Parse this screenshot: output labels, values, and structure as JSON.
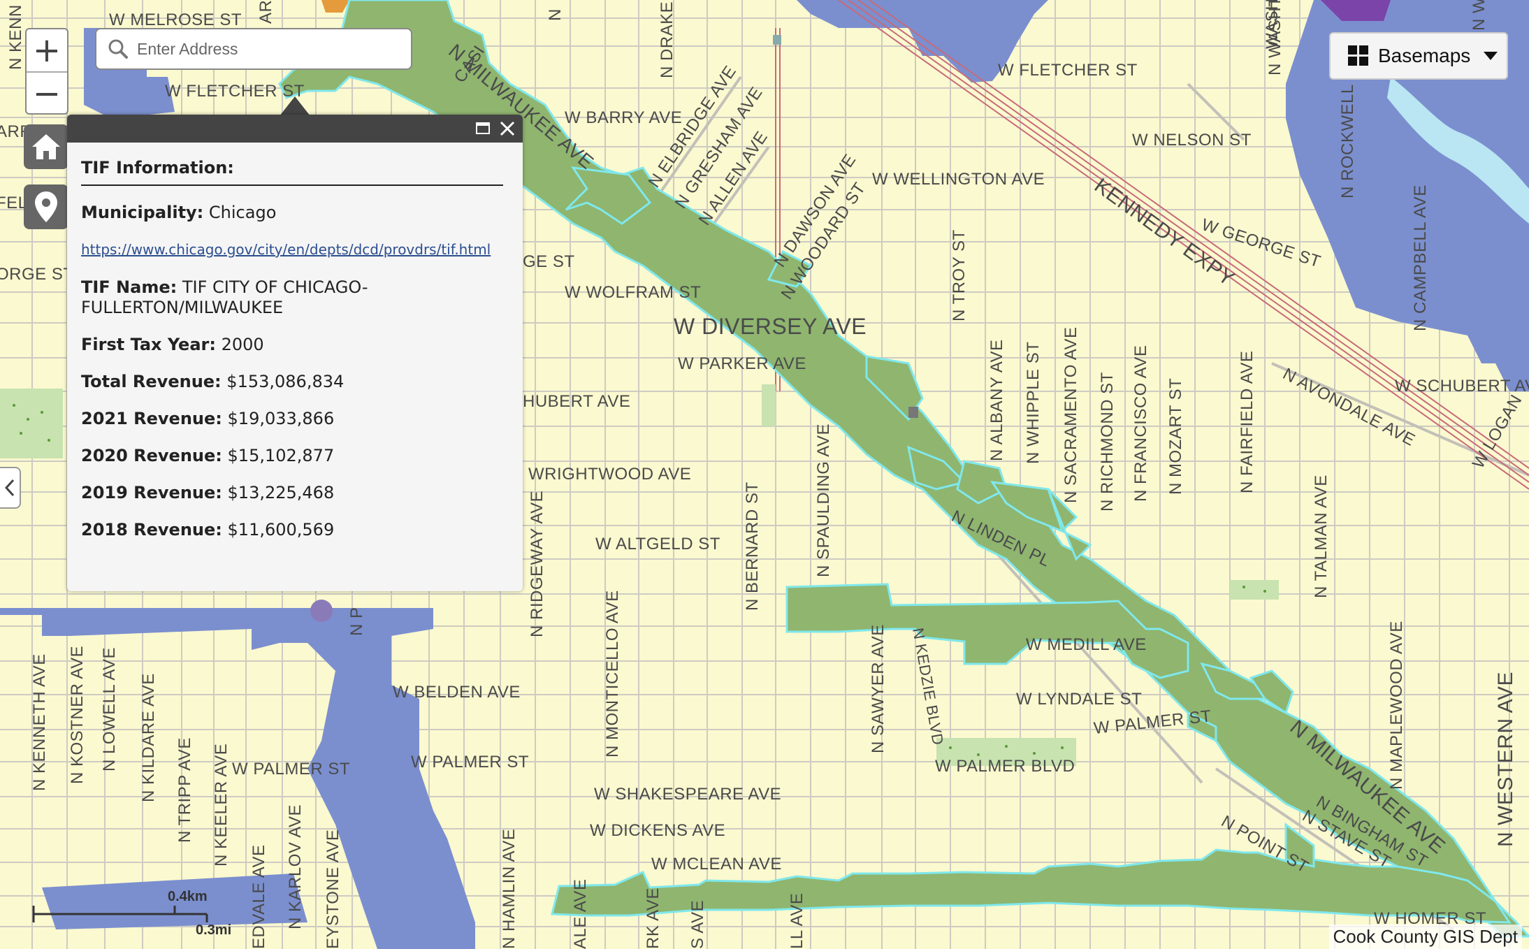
{
  "map": {
    "streets": [
      "W MELROSE ST",
      "W FLETCHER ST",
      "W FLETCHER ST",
      "W BARRY AVE",
      "W NELSON ST",
      "W WELLINGTON AVE",
      "W GEORGE ST",
      "KENNEDY EXPY",
      "W WOLFRAM ST",
      "W DIVERSEY AVE",
      "W PARKER AVE",
      "W SCHUBERT AVE",
      "N AVONDALE AVE",
      "WRIGHTWOOD AVE",
      "W ALTGELD ST",
      "N LINDEN PL",
      "W MEDILL AVE",
      "W LYNDALE ST",
      "W PALMER ST",
      "W BELDEN AVE",
      "W PALMER ST",
      "W PALMER ST",
      "W PALMER BLVD",
      "W SHAKESPEARE AVE",
      "W DICKENS AVE",
      "W MCLEAN AVE",
      "N MILWAUKEE AVE",
      "N MILWAUKEE AVE",
      "N ELBRIDGE AVE",
      "N GRESHAM AVE",
      "N ALLEN AVE",
      "N DAWSON AVE",
      "N WOODARD ST",
      "N TROY ST",
      "N ALBANY AVE",
      "N WHIPPLE ST",
      "N SACRAMENTO AVE",
      "N RICHMOND ST",
      "N FRANCISCO AVE",
      "N MOZART ST",
      "N FAIRFIELD AVE",
      "N TALMAN AVE",
      "N MAPLEWOOD AVE",
      "N WESTERN AVE",
      "N ROCKWELL",
      "N CAMPBELL AVE",
      "N WASHTENAW",
      "N DRAKE AVE",
      "N SPAULDING AVE",
      "N BERNARD ST",
      "N KEDZIE BLVD",
      "N SAWYER AVE",
      "N MONTICELLO AVE",
      "N RIDGEWAY AVE",
      "N HAMLIN AVE",
      "N KENNETH AVE",
      "N KOSTNER AVE",
      "N LOWELL AVE",
      "N KILDARE AVE",
      "N TRIPP AVE",
      "N KEELER AVE",
      "N KARLOV AVE",
      "N POINT ST",
      "N BINGHAM ST",
      "N STAVE ST",
      "W HOMER ST",
      "W LOGAN",
      "N KENN",
      "ARRY AVE",
      "ORGE ST",
      "GE ST",
      "HUBERT AVE",
      "CASI",
      "ARL",
      "WASH",
      "N WES",
      "N P",
      "N",
      "ALE AVE",
      "RK AVE",
      "S AVE",
      "LL AVE",
      "EDVALE AVE",
      "EYSTONE AVE",
      "FEL"
    ]
  },
  "controls": {
    "zoom_in": "+",
    "zoom_out": "−",
    "search_placeholder": "Enter Address",
    "home_icon": "home-icon",
    "locate_icon": "map-pin-icon",
    "basemaps_label": "Basemaps"
  },
  "popup": {
    "title": "TIF Information:",
    "municipality_label": "Municipality:",
    "municipality_value": "Chicago",
    "link": "https://www.chicago.gov/city/en/depts/dcd/provdrs/tif.html",
    "tif_name_label": "TIF Name:",
    "tif_name_value": "TIF CITY OF CHICAGO-FULLERTON/MILWAUKEE",
    "first_tax_year_label": "First Tax Year:",
    "first_tax_year_value": "2000",
    "total_revenue_label": "Total Revenue:",
    "total_revenue_value": "$153,086,834",
    "rev2021_label": "2021 Revenue:",
    "rev2021_value": "$19,033,866",
    "rev2020_label": "2020 Revenue:",
    "rev2020_value": "$15,102,877",
    "rev2019_label": "2019 Revenue:",
    "rev2019_value": "$13,225,468",
    "rev2018_label": "2018 Revenue:",
    "rev2018_value": "$11,600,569"
  },
  "scale": {
    "km": "0.4km",
    "mi": "0.3mi"
  },
  "attribution": "Cook County GIS Dept",
  "colors": {
    "background": "#fbf9cf",
    "tif": "#8fb56f",
    "tif_outline": "#7fe8ec",
    "other_district": "#7b8fcf",
    "purple": "#7a44a8",
    "orange": "#e59a3c",
    "water": "#b9e6f2",
    "street": "#c9c7c0",
    "rail": "#c86a7a"
  }
}
